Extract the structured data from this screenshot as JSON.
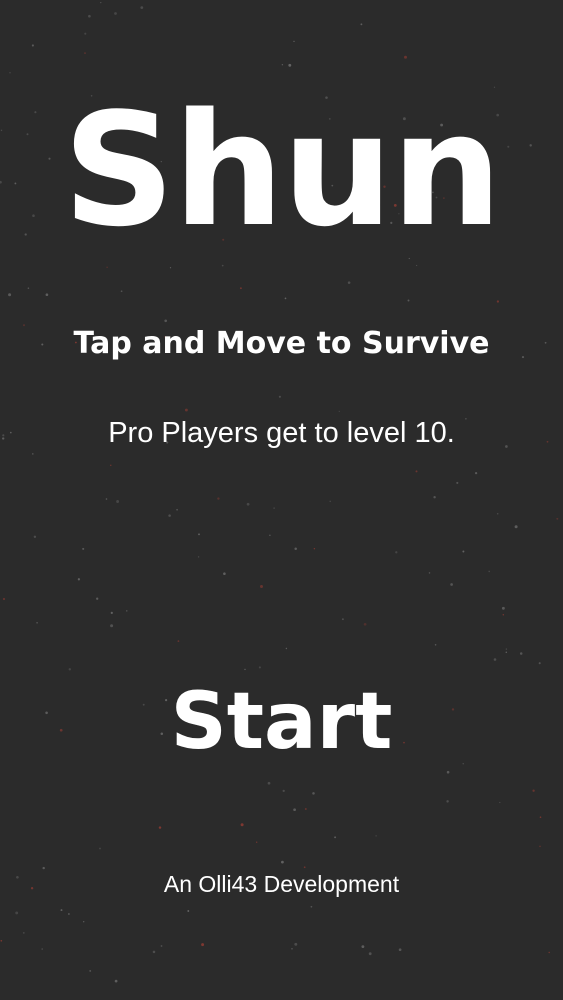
{
  "game": {
    "title": "Shun",
    "tagline": "Tap and Move to Survive",
    "hint": "Pro Players get to level 10.",
    "start_label": "Start",
    "credits": "An Olli43 Development"
  },
  "colors": {
    "background": "#2b2b2b",
    "text": "#ffffff",
    "star_light": "#6a6a6a",
    "star_red": "#8a3a32"
  }
}
